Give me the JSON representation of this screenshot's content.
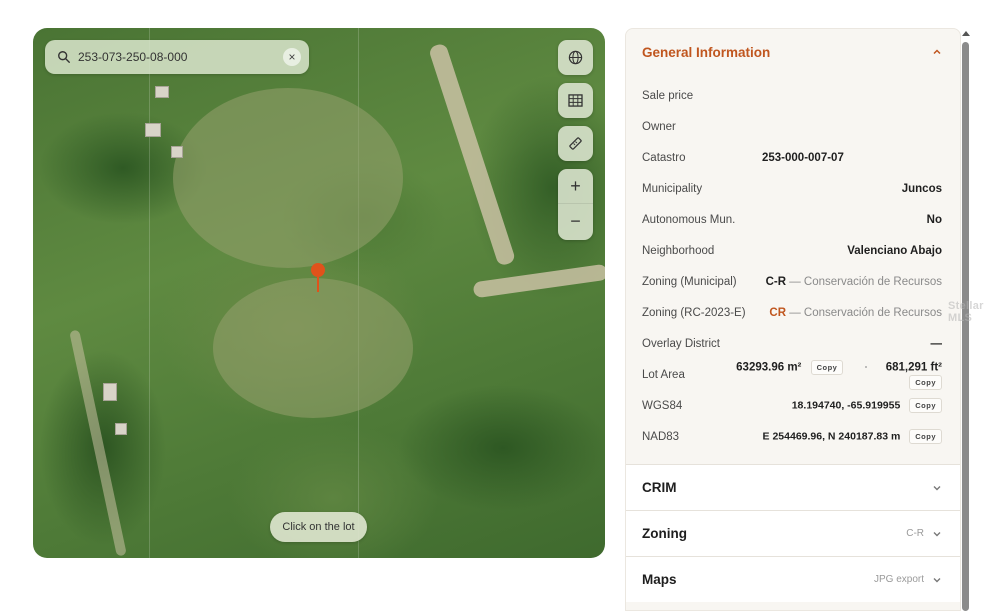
{
  "map": {
    "search_value": "253-073-250-08-000",
    "hint": "Click on the lot"
  },
  "general": {
    "title": "General Information",
    "rows": {
      "sale_price": {
        "label": "Sale price"
      },
      "owner": {
        "label": "Owner"
      },
      "catastro": {
        "label": "Catastro",
        "value": "253-000-007-07"
      },
      "municipality": {
        "label": "Municipality",
        "value": "Juncos"
      },
      "autonomous": {
        "label": "Autonomous Mun.",
        "value": "No"
      },
      "neighborhood": {
        "label": "Neighborhood",
        "value": "Valenciano Abajo"
      },
      "zoning_municipal": {
        "label": "Zoning (Municipal)",
        "code": "C-R",
        "desc": "— Conservación de Recursos"
      },
      "zoning_rc": {
        "label": "Zoning (RC-2023-E)",
        "code": "CR",
        "desc": "— Conservación de Recursos"
      },
      "overlay": {
        "label": "Overlay District",
        "value": "—"
      },
      "lot_area": {
        "label": "Lot Area",
        "m2": "63293.96 m²",
        "ft2": "681,291 ft²"
      },
      "wgs84": {
        "label": "WGS84",
        "value": "18.194740, -65.919955"
      },
      "nad83": {
        "label": "NAD83",
        "value": "E 254469.96, N 240187.83 m"
      }
    },
    "copy_label": "Copy"
  },
  "sections": {
    "crim": {
      "title": "CRIM"
    },
    "zoning": {
      "title": "Zoning",
      "meta": "C-R"
    },
    "maps": {
      "title": "Maps",
      "meta": "JPG export"
    }
  },
  "watermark": "Stellar MLS",
  "colors": {
    "accent": "#c0561f",
    "pin": "#e0521b"
  }
}
